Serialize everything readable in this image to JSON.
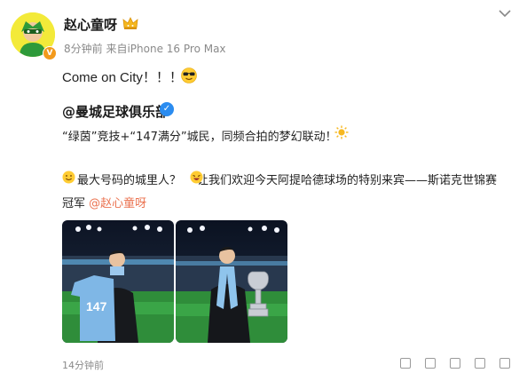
{
  "post": {
    "author": "赵心童呀",
    "meta_time": "8分钟前",
    "meta_source": "来自iPhone 16 Pro Max",
    "text": "Come on City！！！",
    "icons": {
      "avatar": "avatar-hero-icon",
      "crown": "crown-icon",
      "emoji": "sunglasses-emoji-icon",
      "menu": "chevron-down-icon"
    },
    "repost": {
      "author": "@曼城足球俱乐部",
      "verify_mark": "✓",
      "line1": "“绿茵”竞技+“147满分”城民，同频合拍的梦幻联动！",
      "line2": "最大号码的城里人？",
      "line2b": "让我们欢迎今天阿提哈德球场的特别来宾——斯诺克世锦赛",
      "line3a": "冠军",
      "line3_mention": "@赵心童呀",
      "jersey_number": "147"
    },
    "footer_time": "14分钟前"
  },
  "colors": {
    "mention": "#eb7350",
    "verify_blue": "#2b8cf0",
    "avatar_bg": "#f3ea39",
    "badge_orange": "#f39a1b"
  }
}
